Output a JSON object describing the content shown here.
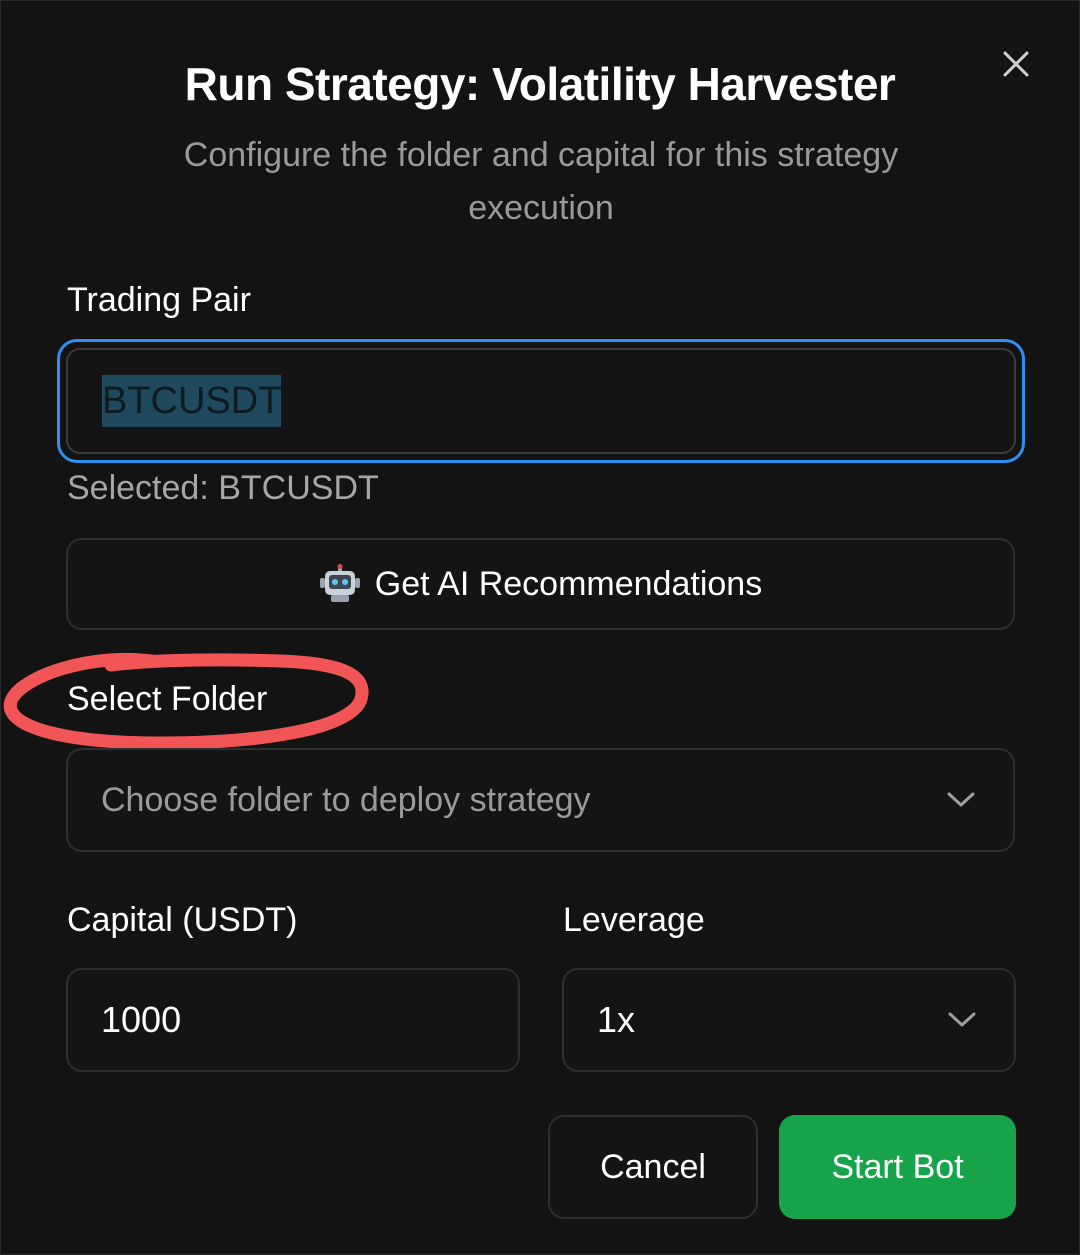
{
  "dialog": {
    "title": "Run Strategy: Volatility Harvester",
    "subtitle": "Configure the folder and capital for this strategy execution",
    "close_icon": "close-icon"
  },
  "trading_pair": {
    "label": "Trading Pair",
    "value": "BTCUSDT",
    "selected_text": "Selected: BTCUSDT"
  },
  "ai_button": {
    "icon": "robot-icon",
    "label": "Get AI Recommendations"
  },
  "folder": {
    "label": "Select Folder",
    "placeholder": "Choose folder to deploy strategy",
    "annotation_color": "#f25555"
  },
  "capital": {
    "label": "Capital (USDT)",
    "value": "1000"
  },
  "leverage": {
    "label": "Leverage",
    "value": "1x"
  },
  "actions": {
    "cancel_label": "Cancel",
    "start_label": "Start Bot"
  },
  "colors": {
    "accent_focus": "#2f8ff0",
    "primary_button": "#16a34a",
    "background": "#131313",
    "selection_highlight": "#1f4a5e"
  }
}
